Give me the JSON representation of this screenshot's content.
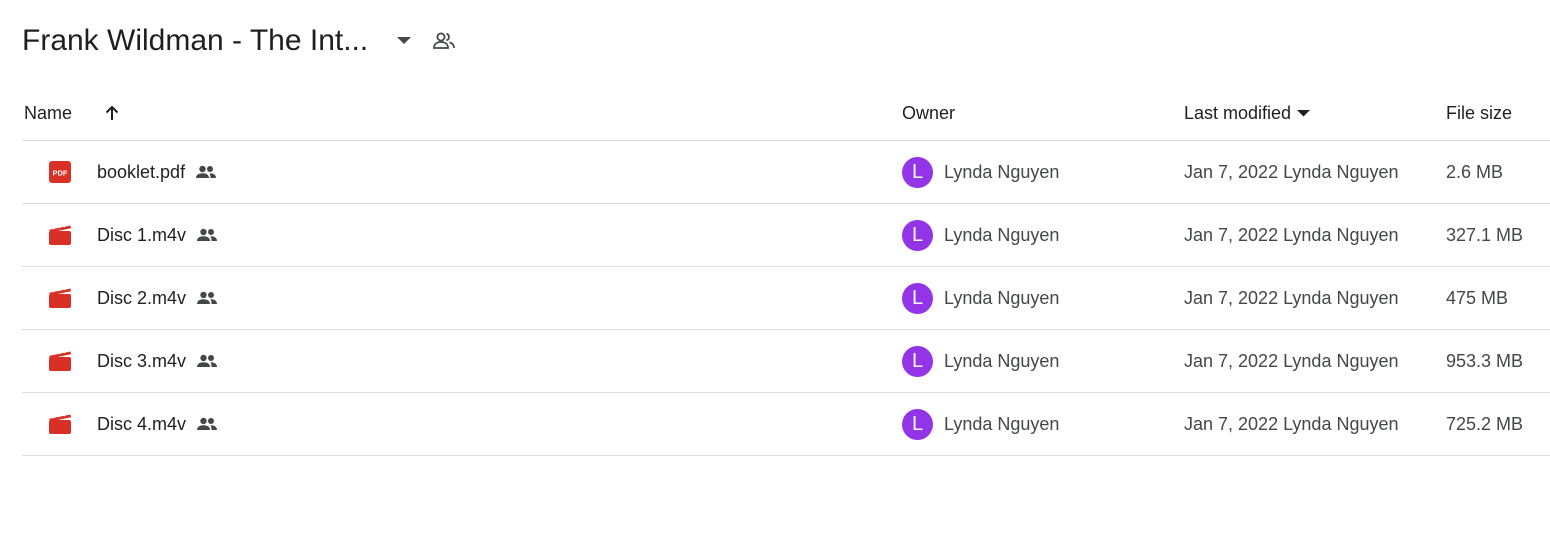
{
  "folder": {
    "title": "Frank Wildman - The Int...",
    "dropdown_icon": "caret-down-icon",
    "share_icon": "people-outline-icon"
  },
  "columns": {
    "name": "Name",
    "name_sort_icon": "arrow-up-icon",
    "owner": "Owner",
    "last_modified": "Last modified",
    "last_modified_sort_icon": "caret-down-icon",
    "file_size": "File size"
  },
  "colors": {
    "file_icon": "#d93025",
    "avatar": "#9334e6",
    "divider": "#dadce0"
  },
  "files": [
    {
      "name": "booklet.pdf",
      "type_icon": "pdf-icon",
      "shared_icon": "shared-people-icon",
      "owner_initial": "L",
      "owner": "Lynda Nguyen",
      "modified": "Jan 7, 2022 Lynda Nguyen",
      "size": "2.6 MB"
    },
    {
      "name": "Disc 1.m4v",
      "type_icon": "video-icon",
      "shared_icon": "shared-people-icon",
      "owner_initial": "L",
      "owner": "Lynda Nguyen",
      "modified": "Jan 7, 2022 Lynda Nguyen",
      "size": "327.1 MB"
    },
    {
      "name": "Disc 2.m4v",
      "type_icon": "video-icon",
      "shared_icon": "shared-people-icon",
      "owner_initial": "L",
      "owner": "Lynda Nguyen",
      "modified": "Jan 7, 2022 Lynda Nguyen",
      "size": "475 MB"
    },
    {
      "name": "Disc 3.m4v",
      "type_icon": "video-icon",
      "shared_icon": "shared-people-icon",
      "owner_initial": "L",
      "owner": "Lynda Nguyen",
      "modified": "Jan 7, 2022 Lynda Nguyen",
      "size": "953.3 MB"
    },
    {
      "name": "Disc 4.m4v",
      "type_icon": "video-icon",
      "shared_icon": "shared-people-icon",
      "owner_initial": "L",
      "owner": "Lynda Nguyen",
      "modified": "Jan 7, 2022 Lynda Nguyen",
      "size": "725.2 MB"
    }
  ]
}
